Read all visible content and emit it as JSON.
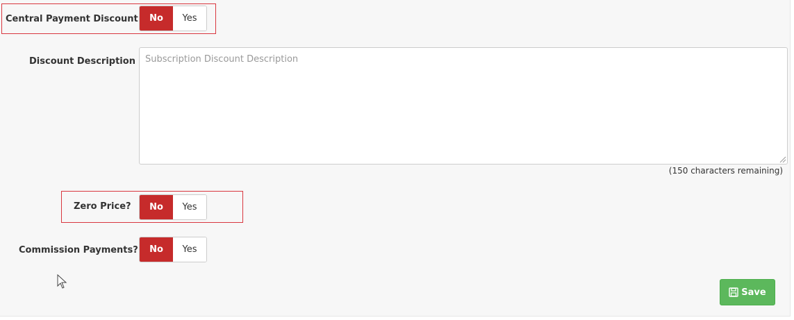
{
  "form": {
    "central_payment_discount": {
      "label": "Central Payment Discount",
      "options": [
        "No",
        "Yes"
      ],
      "selected": "No"
    },
    "discount_description": {
      "label": "Discount Description",
      "placeholder": "Subscription Discount Description",
      "value": "",
      "counter_text": "(150 characters remaining)"
    },
    "zero_price": {
      "label": "Zero Price?",
      "options": [
        "No",
        "Yes"
      ],
      "selected": "No"
    },
    "commission_payments": {
      "label": "Commission Payments?",
      "options": [
        "No",
        "Yes"
      ],
      "selected": "No"
    }
  },
  "actions": {
    "save_label": "Save",
    "save_icon": "floppy-disk-icon"
  },
  "colors": {
    "toggle_active": "#c62b2b",
    "save_button": "#5cb85c",
    "highlight_border": "#d9363e",
    "panel_background": "#f7f7f7"
  }
}
